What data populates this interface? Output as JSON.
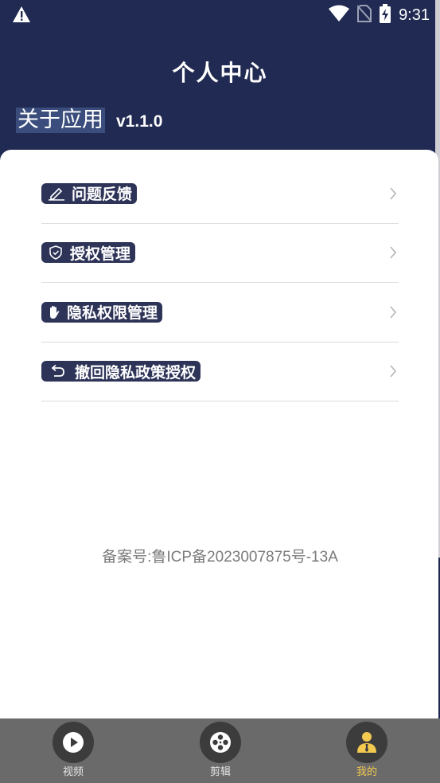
{
  "status_bar": {
    "time": "9:31"
  },
  "header": {
    "title": "个人中心",
    "about_label": "关于应用",
    "version": "v1.1.0"
  },
  "menu": {
    "items": [
      {
        "label": "问题反馈",
        "icon": "edit-icon"
      },
      {
        "label": "授权管理",
        "icon": "shield-icon"
      },
      {
        "label": "隐私权限管理",
        "icon": "hand-icon"
      },
      {
        "label": "撤回隐私政策授权",
        "icon": "undo-icon"
      }
    ]
  },
  "footer_note": "备案号:鲁ICP备2023007875号-13A",
  "tabs": [
    {
      "label": "视频",
      "icon": "play-icon",
      "active": false
    },
    {
      "label": "剪辑",
      "icon": "film-reel-icon",
      "active": false
    },
    {
      "label": "我的",
      "icon": "user-icon",
      "active": true
    }
  ],
  "colors": {
    "header_bg": "#212a52",
    "pill_bg": "#2e3458",
    "tab_bar_bg": "#6a6a6a",
    "tab_active": "#f3c94f"
  }
}
